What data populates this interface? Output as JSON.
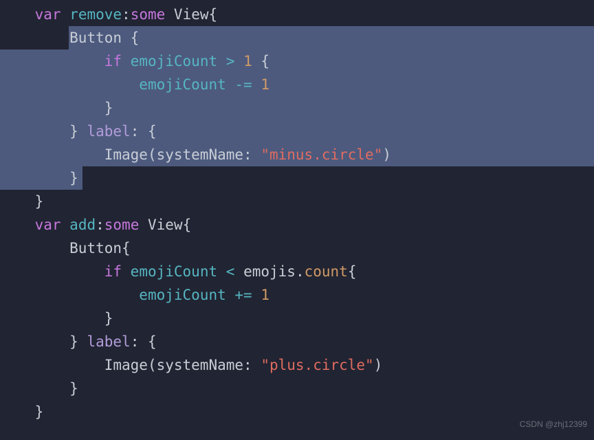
{
  "code": {
    "line1": {
      "indent": "    ",
      "var": "var",
      "sp1": " ",
      "name": "remove",
      "colon": ":",
      "some": "some",
      "sp2": " ",
      "view": "View",
      "brace": "{"
    },
    "line2": {
      "indent": "        ",
      "button": "Button",
      "sp": " ",
      "brace": "{"
    },
    "line3": {
      "indent": "            ",
      "if": "if",
      "sp1": " ",
      "emojiCount": "emojiCount",
      "sp2": " ",
      "gt": ">",
      "sp3": " ",
      "one": "1",
      "sp4": " ",
      "brace": "{"
    },
    "line4": {
      "indent": "                ",
      "emojiCount": "emojiCount",
      "sp1": " ",
      "op": "-=",
      "sp2": " ",
      "one": "1"
    },
    "line5": {
      "indent": "            ",
      "brace": "}"
    },
    "line6": {
      "indent": "        ",
      "brace1": "}",
      "sp1": " ",
      "label": "label",
      "colon": ":",
      "sp2": " ",
      "brace2": "{"
    },
    "line7": {
      "indent": "            ",
      "image": "Image",
      "lparen": "(",
      "param": "systemName",
      "colon": ":",
      "sp": " ",
      "str": "\"minus.circle\"",
      "rparen": ")"
    },
    "line8": {
      "indent": "        ",
      "brace": "}"
    },
    "line9": {
      "indent": "    ",
      "brace": "}"
    },
    "line10": {
      "indent": "    ",
      "var": "var",
      "sp1": " ",
      "name": "add",
      "colon": ":",
      "some": "some",
      "sp2": " ",
      "view": "View",
      "brace": "{"
    },
    "line11": {
      "indent": "        ",
      "button": "Button",
      "brace": "{"
    },
    "line12": {
      "indent": "            ",
      "if": "if",
      "sp1": " ",
      "emojiCount": "emojiCount",
      "sp2": " ",
      "lt": "<",
      "sp3": " ",
      "emojis": "emojis",
      "dot": ".",
      "count": "count",
      "brace": "{"
    },
    "line13": {
      "indent": "                ",
      "emojiCount": "emojiCount",
      "sp1": " ",
      "op": "+=",
      "sp2": " ",
      "one": "1"
    },
    "line14": {
      "indent": "            ",
      "brace": "}"
    },
    "line15": {
      "indent": "        ",
      "brace1": "}",
      "sp1": " ",
      "label": "label",
      "colon": ":",
      "sp2": " ",
      "brace2": "{"
    },
    "line16": {
      "indent": "            ",
      "image": "Image",
      "lparen": "(",
      "param": "systemName",
      "colon": ":",
      "sp": " ",
      "str": "\"plus.circle\"",
      "rparen": ")"
    },
    "line17": {
      "indent": "        ",
      "brace": "}"
    },
    "line18": {
      "indent": "    ",
      "brace": "}"
    }
  },
  "watermark": "CSDN @zhj12399"
}
